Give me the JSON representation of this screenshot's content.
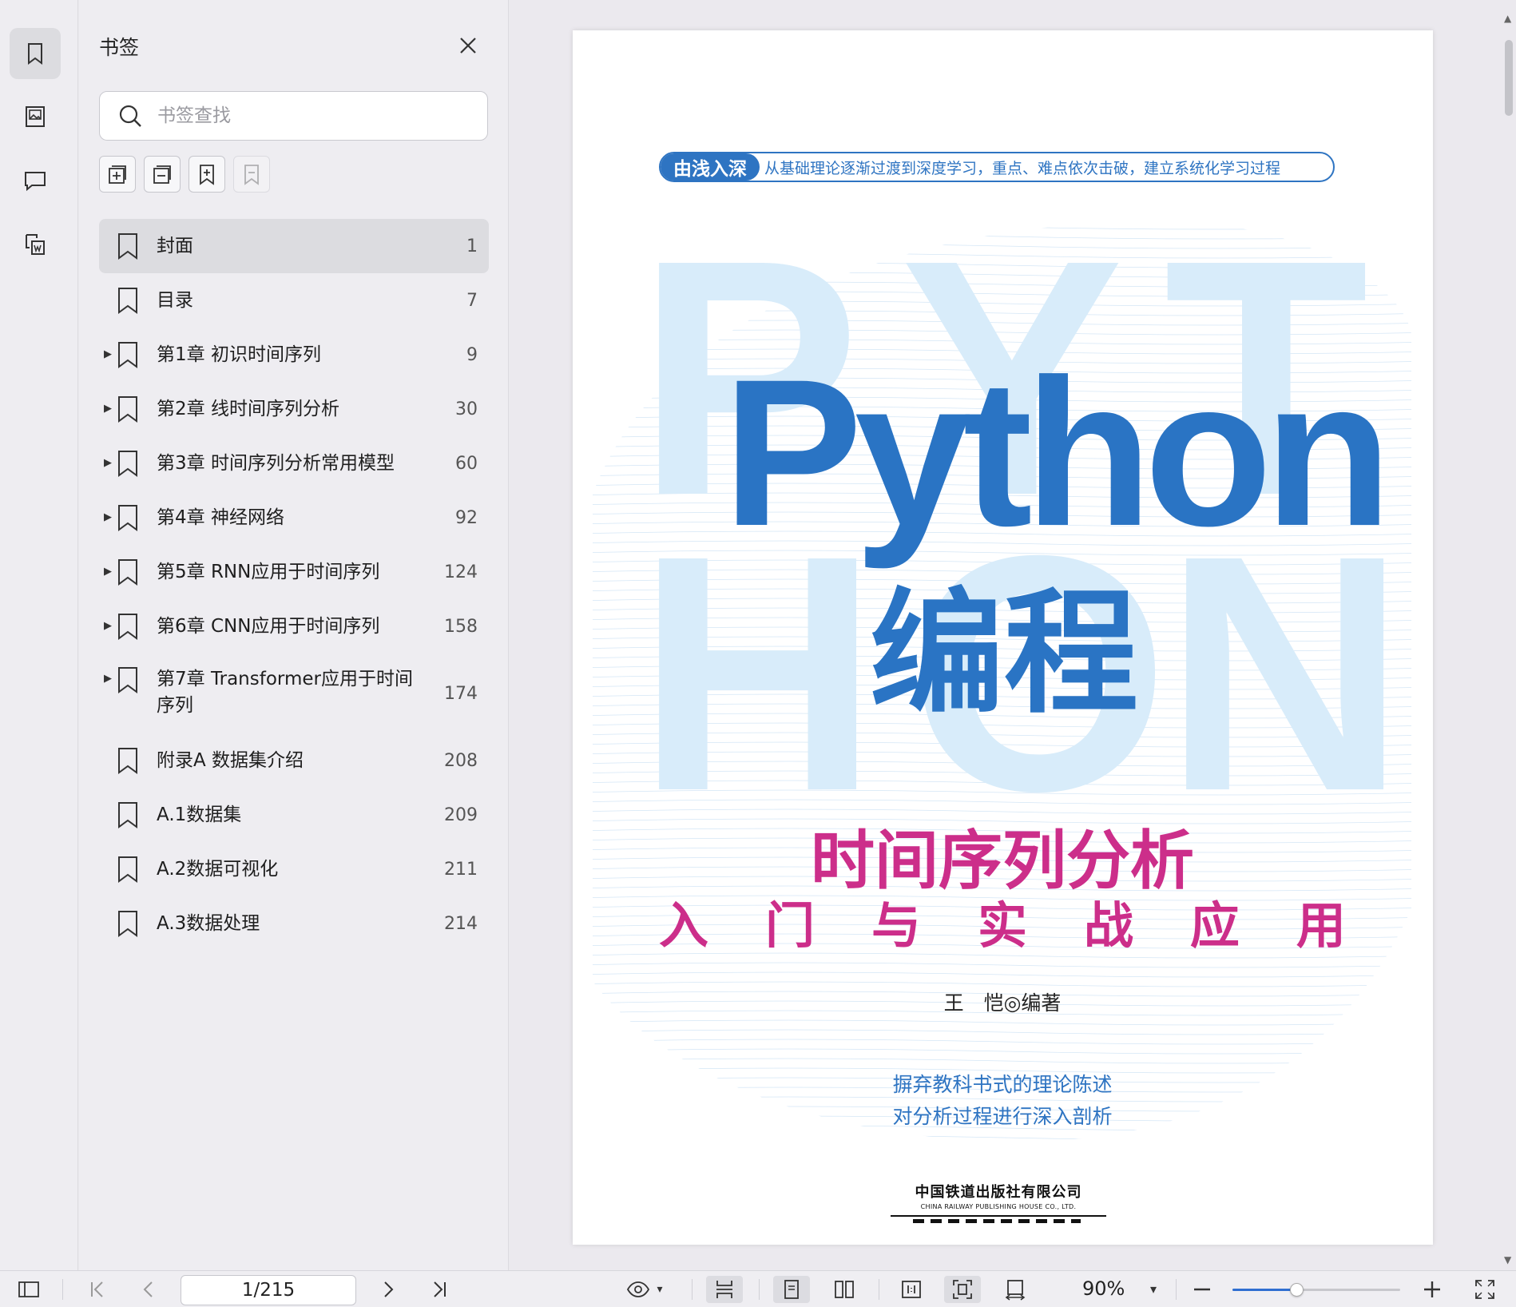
{
  "sidebar_rail": {
    "items": [
      {
        "icon": "bookmark-icon",
        "active": true
      },
      {
        "icon": "thumbnail-icon",
        "active": false
      },
      {
        "icon": "comment-icon",
        "active": false
      },
      {
        "icon": "convert-icon",
        "active": false
      }
    ]
  },
  "bookmark_panel": {
    "title": "书签",
    "search_placeholder": "书签查找",
    "tools": [
      "expand-all-icon",
      "collapse-all-icon",
      "add-bookmark-icon",
      "delete-bookmark-icon"
    ],
    "items": [
      {
        "label": "封面",
        "page": "1",
        "has_children": false,
        "selected": true
      },
      {
        "label": "目录",
        "page": "7",
        "has_children": false,
        "selected": false
      },
      {
        "label": "第1章 初识时间序列",
        "page": "9",
        "has_children": true,
        "selected": false
      },
      {
        "label": "第2章 线时间序列分析",
        "page": "30",
        "has_children": true,
        "selected": false
      },
      {
        "label": "第3章 时间序列分析常用模型",
        "page": "60",
        "has_children": true,
        "selected": false
      },
      {
        "label": "第4章 神经网络",
        "page": "92",
        "has_children": true,
        "selected": false
      },
      {
        "label": "第5章 RNN应用于时间序列",
        "page": "124",
        "has_children": true,
        "selected": false
      },
      {
        "label": "第6章 CNN应用于时间序列",
        "page": "158",
        "has_children": true,
        "selected": false
      },
      {
        "label": "第7章 Transformer应用于时间序列",
        "page": "174",
        "has_children": true,
        "selected": false
      },
      {
        "label": "附录A 数据集介绍",
        "page": "208",
        "has_children": false,
        "selected": false
      },
      {
        "label": "A.1数据集",
        "page": "209",
        "has_children": false,
        "selected": false
      },
      {
        "label": "A.2数据可视化",
        "page": "211",
        "has_children": false,
        "selected": false
      },
      {
        "label": "A.3数据处理",
        "page": "214",
        "has_children": false,
        "selected": false
      }
    ]
  },
  "cover": {
    "tag_badge": "由浅入深",
    "tag_text": "从基础理论逐渐过渡到深度学习，重点、难点依次击破，建立系统化学习过程",
    "bg_letters": [
      "P",
      "Y",
      "T",
      "H",
      "O",
      "N"
    ],
    "title_en": "Python",
    "title_cn": "编程",
    "subtitle": "时间序列分析",
    "subtitle2": [
      "入",
      "门",
      "与",
      "实",
      "战",
      "应",
      "用"
    ],
    "author": "王　恺◎编著",
    "blurb_line1": "摒弃教科书式的理论陈述",
    "blurb_line2": "对分析过程进行深入剖析",
    "publisher_cn": "中国铁道出版社有限公司",
    "publisher_en": "CHINA RAILWAY PUBLISHING HOUSE CO., LTD.",
    "colors": {
      "blue": "#2a74c4",
      "pink": "#cc2e8a",
      "light_blue": "#d8ecfa"
    }
  },
  "toolbar": {
    "page_indicator": "1/215",
    "zoom": "90%",
    "zoom_fraction": 0.38
  }
}
